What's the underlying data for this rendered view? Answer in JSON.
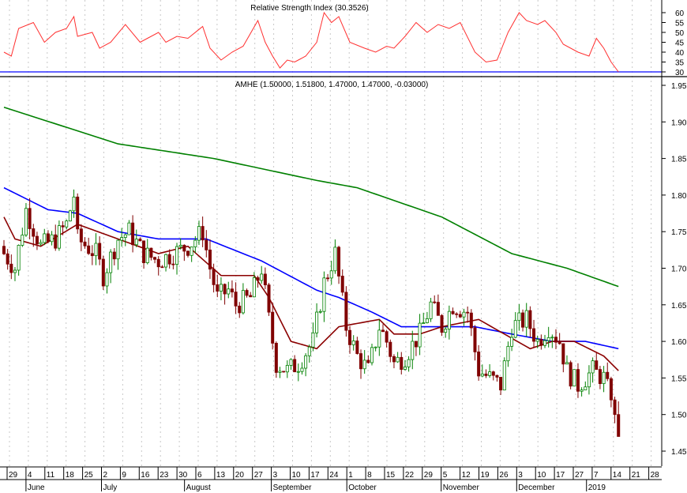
{
  "chart_data": {
    "type": "candlestick",
    "symbol_label": "AMHE (1.50000, 1.51800, 1.47000, 1.47000, -0.03000)",
    "last_ohlc": {
      "open": 1.5,
      "high": 1.518,
      "low": 1.47,
      "close": 1.47,
      "change": -0.03
    },
    "price_axis": {
      "min": 1.45,
      "max": 1.95,
      "ticks": [
        "1.95",
        "1.90",
        "1.85",
        "1.80",
        "1.75",
        "1.70",
        "1.65",
        "1.60",
        "1.55",
        "1.50",
        "1.45"
      ]
    },
    "rsi": {
      "title": "Relative Strength Index (30.3526)",
      "axis": {
        "min": 30,
        "max": 60,
        "ticks": [
          "60",
          "55",
          "50",
          "45",
          "40",
          "35",
          "30"
        ]
      },
      "reference_level": 30,
      "points": [
        [
          0,
          40
        ],
        [
          2,
          38
        ],
        [
          4,
          52
        ],
        [
          8,
          55
        ],
        [
          11,
          45
        ],
        [
          14,
          50
        ],
        [
          17,
          52
        ],
        [
          19,
          58
        ],
        [
          20,
          48
        ],
        [
          24,
          50
        ],
        [
          26,
          42
        ],
        [
          29,
          45
        ],
        [
          33,
          54
        ],
        [
          37,
          45
        ],
        [
          39,
          47
        ],
        [
          42,
          50
        ],
        [
          44,
          45
        ],
        [
          47,
          48
        ],
        [
          50,
          47
        ],
        [
          54,
          53
        ],
        [
          56,
          42
        ],
        [
          59,
          36
        ],
        [
          62,
          40
        ],
        [
          65,
          43
        ],
        [
          69,
          56
        ],
        [
          71,
          45
        ],
        [
          73,
          38
        ],
        [
          75,
          32
        ],
        [
          77,
          36
        ],
        [
          79,
          35
        ],
        [
          82,
          38
        ],
        [
          85,
          45
        ],
        [
          87,
          60
        ],
        [
          89,
          55
        ],
        [
          91,
          58
        ],
        [
          94,
          45
        ],
        [
          98,
          42
        ],
        [
          101,
          40
        ],
        [
          104,
          43
        ],
        [
          106,
          42
        ],
        [
          109,
          48
        ],
        [
          112,
          55
        ],
        [
          115,
          50
        ],
        [
          118,
          54
        ],
        [
          121,
          52
        ],
        [
          124,
          55
        ],
        [
          128,
          40
        ],
        [
          131,
          35
        ],
        [
          134,
          36
        ],
        [
          137,
          50
        ],
        [
          140,
          60
        ],
        [
          142,
          56
        ],
        [
          145,
          54
        ],
        [
          147,
          56
        ],
        [
          150,
          50
        ],
        [
          152,
          44
        ],
        [
          156,
          40
        ],
        [
          159,
          38
        ],
        [
          161,
          47
        ],
        [
          163,
          42
        ],
        [
          165,
          35
        ],
        [
          167,
          30
        ]
      ]
    },
    "closes": [
      [
        0,
        1.72
      ],
      [
        3,
        1.7
      ],
      [
        6,
        1.78
      ],
      [
        10,
        1.73
      ],
      [
        14,
        1.74
      ],
      [
        17,
        1.76
      ],
      [
        19,
        1.8
      ],
      [
        20,
        1.74
      ],
      [
        25,
        1.72
      ],
      [
        27,
        1.69
      ],
      [
        31,
        1.74
      ],
      [
        34,
        1.75
      ],
      [
        38,
        1.72
      ],
      [
        42,
        1.71
      ],
      [
        46,
        1.72
      ],
      [
        50,
        1.73
      ],
      [
        54,
        1.75
      ],
      [
        56,
        1.7
      ],
      [
        58,
        1.66
      ],
      [
        61,
        1.67
      ],
      [
        63,
        1.65
      ],
      [
        67,
        1.66
      ],
      [
        70,
        1.7
      ],
      [
        72,
        1.63
      ],
      [
        74,
        1.57
      ],
      [
        77,
        1.56
      ],
      [
        80,
        1.57
      ],
      [
        84,
        1.6
      ],
      [
        87,
        1.68
      ],
      [
        90,
        1.72
      ],
      [
        93,
        1.62
      ],
      [
        96,
        1.58
      ],
      [
        99,
        1.56
      ],
      [
        102,
        1.62
      ],
      [
        104,
        1.6
      ],
      [
        106,
        1.57
      ],
      [
        109,
        1.58
      ],
      [
        113,
        1.61
      ],
      [
        116,
        1.65
      ],
      [
        119,
        1.62
      ],
      [
        122,
        1.65
      ],
      [
        126,
        1.64
      ],
      [
        129,
        1.56
      ],
      [
        132,
        1.55
      ],
      [
        135,
        1.54
      ],
      [
        138,
        1.62
      ],
      [
        142,
        1.63
      ],
      [
        145,
        1.6
      ],
      [
        148,
        1.62
      ],
      [
        151,
        1.6
      ],
      [
        153,
        1.56
      ],
      [
        156,
        1.54
      ],
      [
        160,
        1.56
      ],
      [
        163,
        1.55
      ],
      [
        165,
        1.52
      ],
      [
        166,
        1.5
      ],
      [
        167,
        1.47
      ]
    ],
    "moving_averages": [
      {
        "name": "MA long",
        "color": "#008000",
        "points": [
          [
            0,
            1.92
          ],
          [
            31,
            1.87
          ],
          [
            57,
            1.85
          ],
          [
            85,
            1.82
          ],
          [
            96,
            1.81
          ],
          [
            119,
            1.77
          ],
          [
            138,
            1.72
          ],
          [
            153,
            1.7
          ],
          [
            167,
            1.675
          ]
        ]
      },
      {
        "name": "MA medium",
        "color": "#0000ff",
        "points": [
          [
            0,
            1.81
          ],
          [
            12,
            1.78
          ],
          [
            20,
            1.775
          ],
          [
            31,
            1.75
          ],
          [
            42,
            1.74
          ],
          [
            55,
            1.74
          ],
          [
            70,
            1.71
          ],
          [
            85,
            1.67
          ],
          [
            91,
            1.66
          ],
          [
            100,
            1.64
          ],
          [
            108,
            1.62
          ],
          [
            119,
            1.62
          ],
          [
            128,
            1.62
          ],
          [
            138,
            1.61
          ],
          [
            149,
            1.6
          ],
          [
            158,
            1.6
          ],
          [
            167,
            1.59
          ]
        ]
      },
      {
        "name": "MA short",
        "color": "#8b0000",
        "points": [
          [
            0,
            1.77
          ],
          [
            3,
            1.74
          ],
          [
            10,
            1.73
          ],
          [
            20,
            1.76
          ],
          [
            31,
            1.74
          ],
          [
            42,
            1.72
          ],
          [
            50,
            1.73
          ],
          [
            59,
            1.69
          ],
          [
            68,
            1.69
          ],
          [
            72,
            1.66
          ],
          [
            78,
            1.6
          ],
          [
            85,
            1.59
          ],
          [
            91,
            1.62
          ],
          [
            102,
            1.63
          ],
          [
            106,
            1.61
          ],
          [
            113,
            1.61
          ],
          [
            119,
            1.62
          ],
          [
            129,
            1.63
          ],
          [
            136,
            1.61
          ],
          [
            143,
            1.59
          ],
          [
            149,
            1.6
          ],
          [
            155,
            1.6
          ],
          [
            163,
            1.58
          ],
          [
            167,
            1.56
          ]
        ]
      }
    ],
    "x_ticks": [
      "29",
      "4",
      "11",
      "18",
      "25",
      "2",
      "9",
      "16",
      "23",
      "30",
      "6",
      "13",
      "20",
      "27",
      "3",
      "10",
      "17",
      "24",
      "1",
      "8",
      "15",
      "22",
      "29",
      "5",
      "12",
      "19",
      "26",
      "3",
      "10",
      "17",
      "27",
      "7",
      "14",
      "21",
      "28"
    ],
    "months": [
      {
        "label": "June",
        "tick": 1
      },
      {
        "label": "July",
        "tick": 5
      },
      {
        "label": "August",
        "tick": 9.4
      },
      {
        "label": "September",
        "tick": 14
      },
      {
        "label": "October",
        "tick": 18
      },
      {
        "label": "November",
        "tick": 23
      },
      {
        "label": "December",
        "tick": 27
      },
      {
        "label": "2019",
        "tick": 30.7
      }
    ],
    "colors": {
      "up": "#008000",
      "down": "#800000",
      "rsi": "#ff3030",
      "rsi_ref": "#0000ff"
    }
  }
}
